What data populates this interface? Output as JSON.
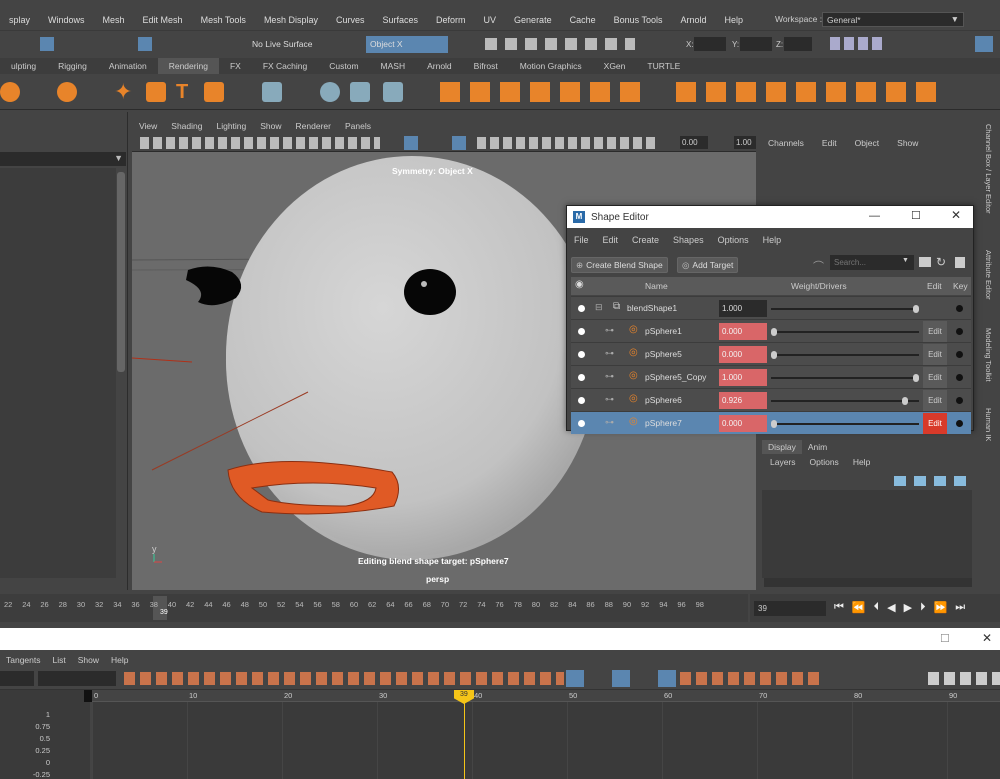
{
  "main_menu": [
    "splay",
    "Windows",
    "Mesh",
    "Edit Mesh",
    "Mesh Tools",
    "Mesh Display",
    "Curves",
    "Surfaces",
    "Deform",
    "UV",
    "Generate",
    "Cache",
    "Bonus Tools",
    "Arnold",
    "Help"
  ],
  "workspace": {
    "label": "Workspace :",
    "value": "General*"
  },
  "toolbar": {
    "live_surface": "No Live Surface",
    "symmetry": "Object X",
    "x_label": "X:",
    "y_label": "Y:",
    "z_label": "Z:"
  },
  "shelf_tabs": [
    "ulpting",
    "Rigging",
    "Animation",
    "Rendering",
    "FX",
    "FX Caching",
    "Custom",
    "MASH",
    "Arnold",
    "Bifrost",
    "Motion Graphics",
    "XGen",
    "TURTLE"
  ],
  "viewport": {
    "menu": [
      "View",
      "Shading",
      "Lighting",
      "Show",
      "Renderer",
      "Panels"
    ],
    "field1": "0.00",
    "field2": "1.00",
    "symmetry_label": "Symmetry: Object X",
    "status": "Editing blend shape target: pSphere7",
    "camera": "persp",
    "axis_y": "y"
  },
  "channel_box": {
    "menu": [
      "Channels",
      "Edit",
      "Object",
      "Show"
    ],
    "side_tab": "Channel Box / Layer Editor"
  },
  "side_tabs": [
    "Attribute Editor",
    "Modeling Toolkit",
    "Human IK"
  ],
  "layer_editor": {
    "tabs": [
      "Display",
      "Anim"
    ],
    "menu": [
      "Layers",
      "Options",
      "Help"
    ]
  },
  "shape_editor": {
    "title": "Shape Editor",
    "menu": [
      "File",
      "Edit",
      "Create",
      "Shapes",
      "Options",
      "Help"
    ],
    "create_button": "Create Blend Shape",
    "add_target_button": "Add Target",
    "search_placeholder": "Search...",
    "columns": {
      "name": "Name",
      "weight": "Weight/Drivers",
      "edit": "Edit",
      "key": "Key"
    },
    "rows": [
      {
        "name": "blendShape1",
        "value": "1.000",
        "weight": 1.0,
        "edit": "",
        "type": "group",
        "red": false
      },
      {
        "name": "pSphere1",
        "value": "0.000",
        "weight": 0.0,
        "edit": "Edit",
        "type": "target",
        "red": true
      },
      {
        "name": "pSphere5",
        "value": "0.000",
        "weight": 0.0,
        "edit": "Edit",
        "type": "target",
        "red": true
      },
      {
        "name": "pSphere5_Copy",
        "value": "1.000",
        "weight": 1.0,
        "edit": "Edit",
        "type": "target",
        "red": true
      },
      {
        "name": "pSphere6",
        "value": "0.926",
        "weight": 0.926,
        "edit": "Edit",
        "type": "target",
        "red": true
      },
      {
        "name": "pSphere7",
        "value": "0.000",
        "weight": 0.0,
        "edit": "Edit",
        "type": "target",
        "red": true,
        "selected": true
      }
    ]
  },
  "timeline": {
    "ticks": [
      "22",
      "24",
      "26",
      "28",
      "30",
      "32",
      "34",
      "36",
      "38",
      "40",
      "42",
      "44",
      "46",
      "48",
      "50",
      "52",
      "54",
      "56",
      "58",
      "60",
      "62",
      "64",
      "66",
      "68",
      "70",
      "72",
      "74",
      "76",
      "78",
      "80",
      "82",
      "84",
      "86",
      "88",
      "90",
      "92",
      "94",
      "96",
      "98"
    ],
    "current": "39"
  },
  "playback": {
    "frame": "39"
  },
  "graph_editor": {
    "menu": [
      "Tangents",
      "List",
      "Show",
      "Help"
    ],
    "ruler": [
      "0",
      "10",
      "20",
      "30",
      "40",
      "50",
      "60",
      "70",
      "80",
      "90"
    ],
    "current": "39",
    "yaxis": [
      "1",
      "0.75",
      "0.5",
      "0.25",
      "0",
      "-0.25"
    ]
  },
  "colors": {
    "accent": "#5b86b0",
    "weight_red": "#d96668",
    "edit_red": "#d83a2a",
    "lips": "#e05a25",
    "shelf_icon": "#e8842a"
  }
}
